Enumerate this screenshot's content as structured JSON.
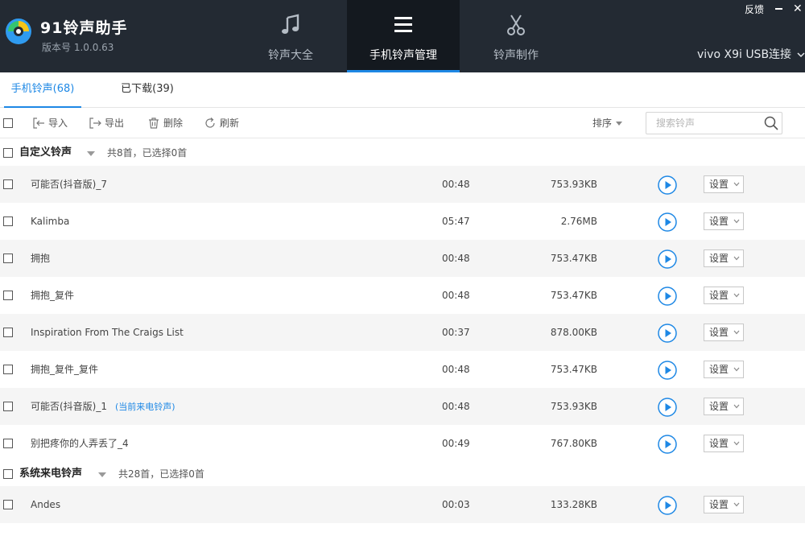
{
  "header": {
    "app_title": "91铃声助手",
    "app_version": "版本号 1.0.0.63",
    "tabs": [
      {
        "label": "铃声大全",
        "icon": "music-note-icon"
      },
      {
        "label": "手机铃声管理",
        "icon": "menu-icon",
        "active": true
      },
      {
        "label": "铃声制作",
        "icon": "scissors-icon"
      }
    ],
    "feedback": "反馈",
    "device": "vivo X9i  USB连接",
    "accent_color": "#1e88e5",
    "background_color": "#232a33"
  },
  "subtabs": [
    {
      "label": "手机铃声(68)",
      "active": true
    },
    {
      "label": "已下载(39)"
    }
  ],
  "toolbar": {
    "import": "导入",
    "export": "导出",
    "delete": "删除",
    "refresh": "刷新",
    "sort": "排序",
    "search_placeholder": "搜索铃声"
  },
  "groups": [
    {
      "title": "自定义铃声",
      "count": "共8首，已选择0首",
      "items": [
        {
          "name": "可能否(抖音版)_7",
          "duration": "00:48",
          "size": "753.93KB",
          "setting": "设置"
        },
        {
          "name": "Kalimba",
          "duration": "05:47",
          "size": "2.76MB",
          "setting": "设置"
        },
        {
          "name": "拥抱",
          "duration": "00:48",
          "size": "753.47KB",
          "setting": "设置"
        },
        {
          "name": "拥抱_复件",
          "duration": "00:48",
          "size": "753.47KB",
          "setting": "设置"
        },
        {
          "name": "Inspiration From The Craigs List",
          "duration": "00:37",
          "size": "878.00KB",
          "setting": "设置"
        },
        {
          "name": "拥抱_复件_复件",
          "duration": "00:48",
          "size": "753.47KB",
          "setting": "设置"
        },
        {
          "name": "可能否(抖音版)_1",
          "tag": "(当前来电铃声)",
          "duration": "00:48",
          "size": "753.93KB",
          "setting": "设置"
        },
        {
          "name": "别把疼你的人弄丢了_4",
          "duration": "00:49",
          "size": "767.80KB",
          "setting": "设置"
        }
      ]
    },
    {
      "title": "系统来电铃声",
      "count": "共28首，已选择0首",
      "items": [
        {
          "name": "Andes",
          "duration": "00:03",
          "size": "133.28KB",
          "setting": "设置"
        }
      ]
    }
  ]
}
